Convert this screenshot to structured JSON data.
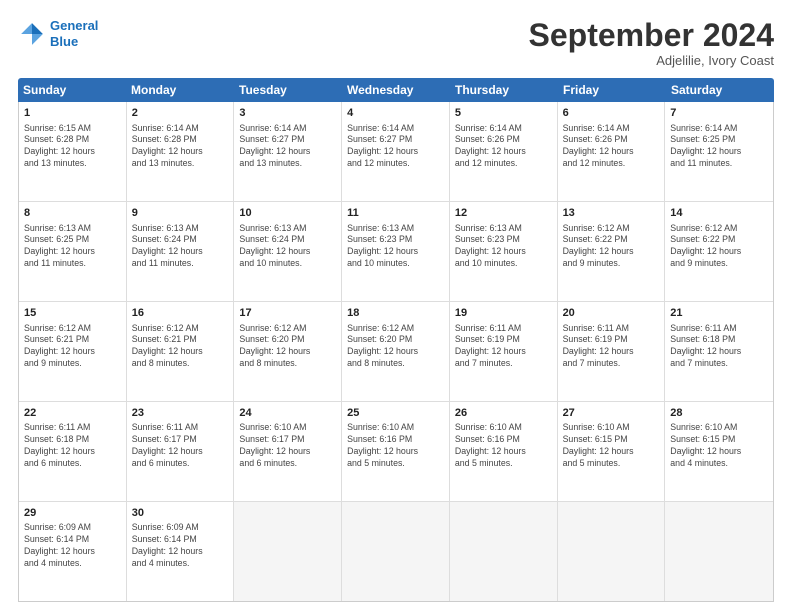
{
  "header": {
    "logo_line1": "General",
    "logo_line2": "Blue",
    "month": "September 2024",
    "location": "Adjelilie, Ivory Coast"
  },
  "weekdays": [
    "Sunday",
    "Monday",
    "Tuesday",
    "Wednesday",
    "Thursday",
    "Friday",
    "Saturday"
  ],
  "rows": [
    [
      {
        "day": 1,
        "info": "Sunrise: 6:15 AM\nSunset: 6:28 PM\nDaylight: 12 hours\nand 13 minutes."
      },
      {
        "day": 2,
        "info": "Sunrise: 6:14 AM\nSunset: 6:28 PM\nDaylight: 12 hours\nand 13 minutes."
      },
      {
        "day": 3,
        "info": "Sunrise: 6:14 AM\nSunset: 6:27 PM\nDaylight: 12 hours\nand 13 minutes."
      },
      {
        "day": 4,
        "info": "Sunrise: 6:14 AM\nSunset: 6:27 PM\nDaylight: 12 hours\nand 12 minutes."
      },
      {
        "day": 5,
        "info": "Sunrise: 6:14 AM\nSunset: 6:26 PM\nDaylight: 12 hours\nand 12 minutes."
      },
      {
        "day": 6,
        "info": "Sunrise: 6:14 AM\nSunset: 6:26 PM\nDaylight: 12 hours\nand 12 minutes."
      },
      {
        "day": 7,
        "info": "Sunrise: 6:14 AM\nSunset: 6:25 PM\nDaylight: 12 hours\nand 11 minutes."
      }
    ],
    [
      {
        "day": 8,
        "info": "Sunrise: 6:13 AM\nSunset: 6:25 PM\nDaylight: 12 hours\nand 11 minutes."
      },
      {
        "day": 9,
        "info": "Sunrise: 6:13 AM\nSunset: 6:24 PM\nDaylight: 12 hours\nand 11 minutes."
      },
      {
        "day": 10,
        "info": "Sunrise: 6:13 AM\nSunset: 6:24 PM\nDaylight: 12 hours\nand 10 minutes."
      },
      {
        "day": 11,
        "info": "Sunrise: 6:13 AM\nSunset: 6:23 PM\nDaylight: 12 hours\nand 10 minutes."
      },
      {
        "day": 12,
        "info": "Sunrise: 6:13 AM\nSunset: 6:23 PM\nDaylight: 12 hours\nand 10 minutes."
      },
      {
        "day": 13,
        "info": "Sunrise: 6:12 AM\nSunset: 6:22 PM\nDaylight: 12 hours\nand 9 minutes."
      },
      {
        "day": 14,
        "info": "Sunrise: 6:12 AM\nSunset: 6:22 PM\nDaylight: 12 hours\nand 9 minutes."
      }
    ],
    [
      {
        "day": 15,
        "info": "Sunrise: 6:12 AM\nSunset: 6:21 PM\nDaylight: 12 hours\nand 9 minutes."
      },
      {
        "day": 16,
        "info": "Sunrise: 6:12 AM\nSunset: 6:21 PM\nDaylight: 12 hours\nand 8 minutes."
      },
      {
        "day": 17,
        "info": "Sunrise: 6:12 AM\nSunset: 6:20 PM\nDaylight: 12 hours\nand 8 minutes."
      },
      {
        "day": 18,
        "info": "Sunrise: 6:12 AM\nSunset: 6:20 PM\nDaylight: 12 hours\nand 8 minutes."
      },
      {
        "day": 19,
        "info": "Sunrise: 6:11 AM\nSunset: 6:19 PM\nDaylight: 12 hours\nand 7 minutes."
      },
      {
        "day": 20,
        "info": "Sunrise: 6:11 AM\nSunset: 6:19 PM\nDaylight: 12 hours\nand 7 minutes."
      },
      {
        "day": 21,
        "info": "Sunrise: 6:11 AM\nSunset: 6:18 PM\nDaylight: 12 hours\nand 7 minutes."
      }
    ],
    [
      {
        "day": 22,
        "info": "Sunrise: 6:11 AM\nSunset: 6:18 PM\nDaylight: 12 hours\nand 6 minutes."
      },
      {
        "day": 23,
        "info": "Sunrise: 6:11 AM\nSunset: 6:17 PM\nDaylight: 12 hours\nand 6 minutes."
      },
      {
        "day": 24,
        "info": "Sunrise: 6:10 AM\nSunset: 6:17 PM\nDaylight: 12 hours\nand 6 minutes."
      },
      {
        "day": 25,
        "info": "Sunrise: 6:10 AM\nSunset: 6:16 PM\nDaylight: 12 hours\nand 5 minutes."
      },
      {
        "day": 26,
        "info": "Sunrise: 6:10 AM\nSunset: 6:16 PM\nDaylight: 12 hours\nand 5 minutes."
      },
      {
        "day": 27,
        "info": "Sunrise: 6:10 AM\nSunset: 6:15 PM\nDaylight: 12 hours\nand 5 minutes."
      },
      {
        "day": 28,
        "info": "Sunrise: 6:10 AM\nSunset: 6:15 PM\nDaylight: 12 hours\nand 4 minutes."
      }
    ],
    [
      {
        "day": 29,
        "info": "Sunrise: 6:09 AM\nSunset: 6:14 PM\nDaylight: 12 hours\nand 4 minutes."
      },
      {
        "day": 30,
        "info": "Sunrise: 6:09 AM\nSunset: 6:14 PM\nDaylight: 12 hours\nand 4 minutes."
      },
      {
        "day": null
      },
      {
        "day": null
      },
      {
        "day": null
      },
      {
        "day": null
      },
      {
        "day": null
      }
    ]
  ]
}
